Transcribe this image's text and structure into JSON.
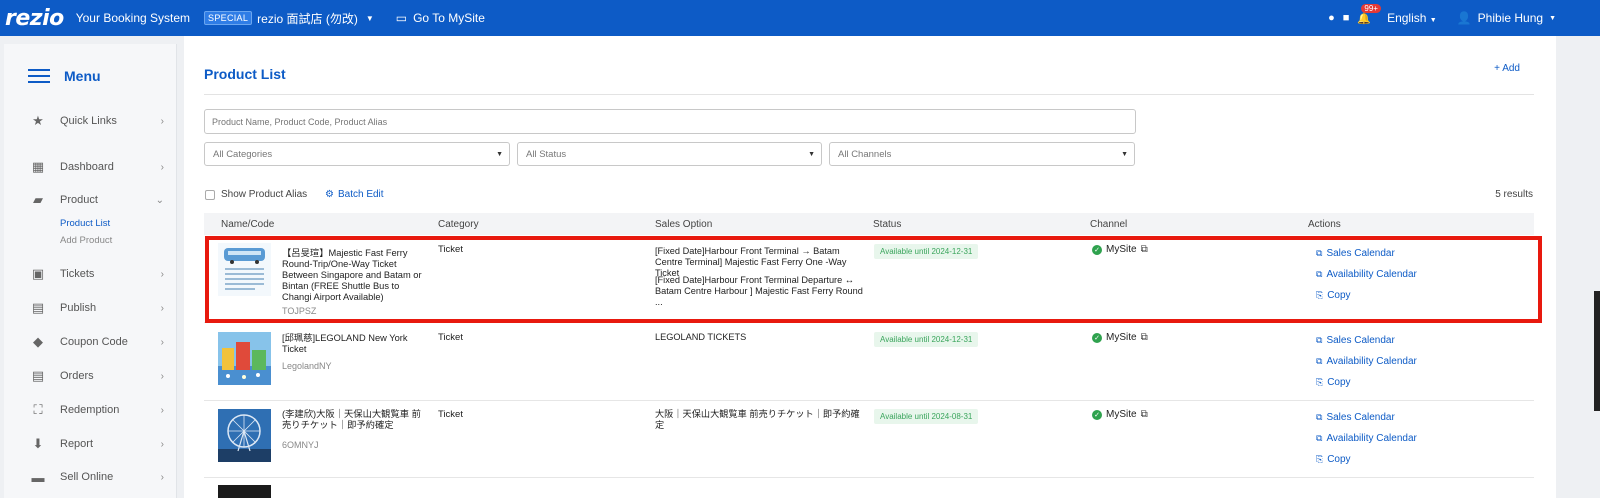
{
  "topbar": {
    "logo": "rezio",
    "system_title": "Your Booking System",
    "special_badge": "SPECIAL",
    "store_name": "rezio 面試店 (勿改)",
    "go_to_mysite": "Go To MySite",
    "notifications_count": "99+",
    "language": "English",
    "user_name": "Phibie Hung"
  },
  "sidebar": {
    "menu_label": "Menu",
    "items": [
      {
        "label": "Quick Links",
        "icon": "star-icon"
      },
      {
        "label": "Dashboard",
        "icon": "dashboard-icon"
      },
      {
        "label": "Product",
        "icon": "folder-star-icon"
      },
      {
        "label": "Tickets",
        "icon": "ticket-icon"
      },
      {
        "label": "Publish",
        "icon": "calendar-icon"
      },
      {
        "label": "Coupon Code",
        "icon": "tag-icon"
      },
      {
        "label": "Orders",
        "icon": "document-icon"
      },
      {
        "label": "Redemption",
        "icon": "scan-icon"
      },
      {
        "label": "Report",
        "icon": "download-icon"
      },
      {
        "label": "Sell Online",
        "icon": "store-icon"
      }
    ],
    "product_sub": [
      "Product List",
      "Add Product"
    ]
  },
  "main": {
    "title": "Product List",
    "add_label": "Add",
    "search_placeholder": "Product Name, Product Code, Product Alias",
    "filters": {
      "category": "All Categories",
      "status": "All Status",
      "channel": "All Channels"
    },
    "show_alias_label": "Show Product Alias",
    "batch_edit_label": "Batch Edit",
    "results": "5 results",
    "columns": [
      "Name/Code",
      "Category",
      "Sales Option",
      "Status",
      "Channel",
      "Actions"
    ],
    "actions": {
      "sales_calendar": "Sales Calendar",
      "availability_calendar": "Availability Calendar",
      "copy": "Copy"
    },
    "rows": [
      {
        "name": "【呂旻瑄】Majestic Fast Ferry Round-Trip/One-Way Ticket Between Singapore and Batam or Bintan (FREE Shuttle Bus to Changi Airport Available)",
        "code": "TOJPSZ",
        "category": "Ticket",
        "options": [
          "[Fixed Date]Harbour Front Terminal → Batam Centre Terminal] Majestic Fast Ferry One -Way Ticket",
          "[Fixed Date]Harbour Front Terminal Departure ↔ Batam Centre Harbour ] Majestic Fast Ferry Round ..."
        ],
        "status": "Available until 2024-12-31",
        "channel": "MySite"
      },
      {
        "name": "[邱珮慈]LEGOLAND New York Ticket",
        "code": "LegolandNY",
        "category": "Ticket",
        "options": [
          "LEGOLAND TICKETS"
        ],
        "status": "Available until 2024-12-31",
        "channel": "MySite"
      },
      {
        "name": "(李建欣)大阪｜天保山大観覧車 前売りチケット｜即予約確定",
        "code": "6OMNYJ",
        "category": "Ticket",
        "options": [
          "大阪｜天保山大観覧車 前売りチケット｜即予約確定"
        ],
        "status": "Available until 2024-08-31",
        "channel": "MySite"
      }
    ]
  },
  "colors": {
    "brand": "#0d5bc6",
    "highlight": "#e8190e",
    "status_green": "#3aa55c"
  }
}
